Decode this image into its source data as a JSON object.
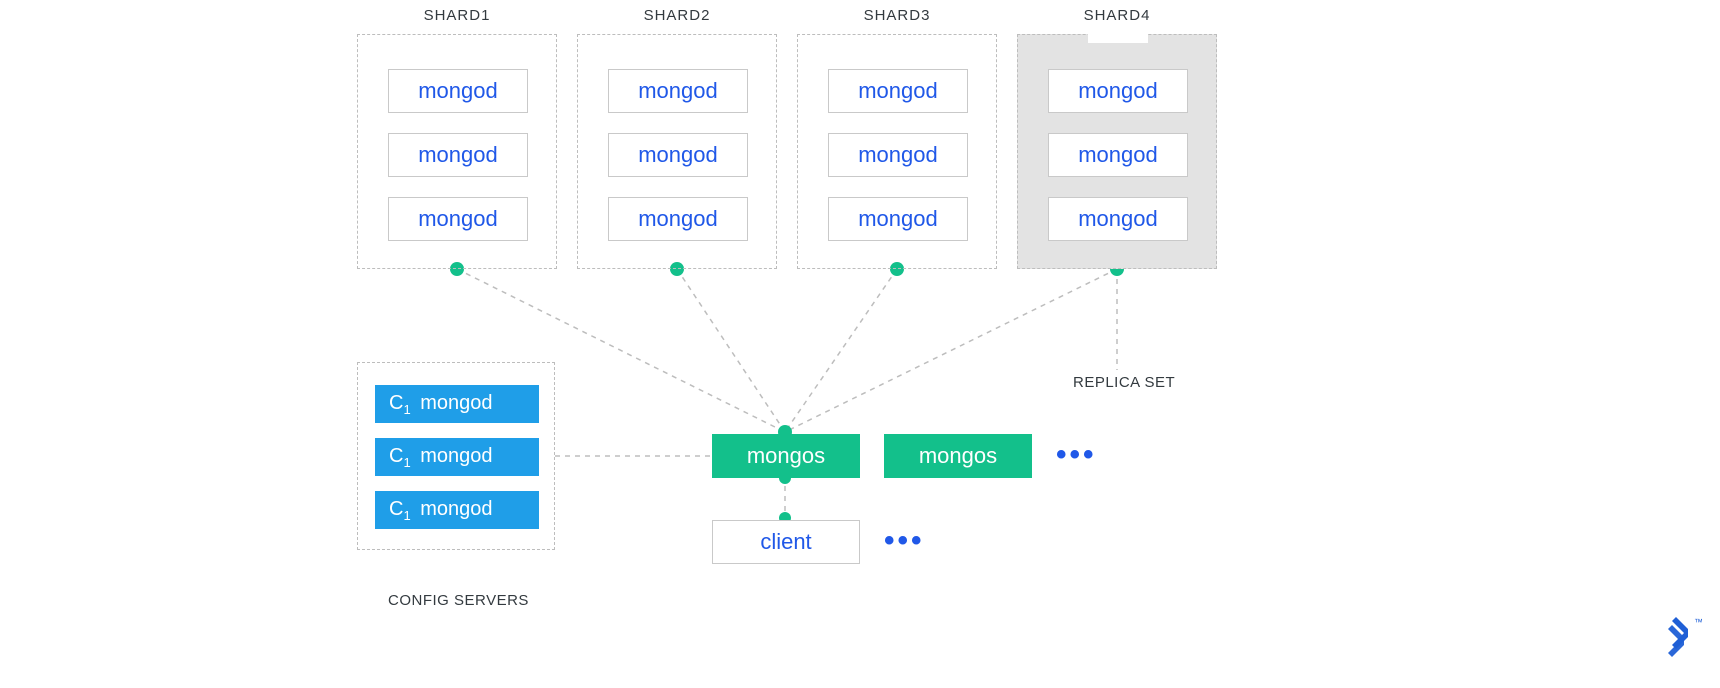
{
  "shards": [
    {
      "title": "SHARD1",
      "nodes": [
        "mongod",
        "mongod",
        "mongod"
      ]
    },
    {
      "title": "SHARD2",
      "nodes": [
        "mongod",
        "mongod",
        "mongod"
      ]
    },
    {
      "title": "SHARD3",
      "nodes": [
        "mongod",
        "mongod",
        "mongod"
      ]
    },
    {
      "title": "SHARD4",
      "nodes": [
        "mongod",
        "mongod",
        "mongod"
      ],
      "highlight": true
    }
  ],
  "replica_set_label": "REPLICA SET",
  "config_servers": {
    "label": "CONFIG SERVERS",
    "nodes": [
      {
        "prefix": "C",
        "sub": "1",
        "text": "mongod"
      },
      {
        "prefix": "C",
        "sub": "1",
        "text": "mongod"
      },
      {
        "prefix": "C",
        "sub": "1",
        "text": "mongod"
      }
    ]
  },
  "routers": [
    "mongos",
    "mongos"
  ],
  "routers_more": "•••",
  "clients": [
    "client"
  ],
  "clients_more": "•••",
  "logo_tm": "™"
}
